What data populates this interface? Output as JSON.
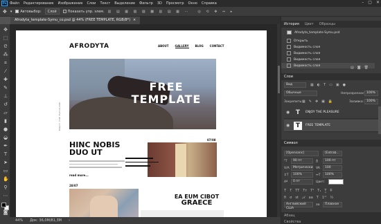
{
  "menubar": {
    "app_badge": "Ps",
    "items": [
      "Файл",
      "Редактирование",
      "Изображение",
      "Слои",
      "Текст",
      "Выделение",
      "Фильтр",
      "3D",
      "Просмотр",
      "Окно",
      "Справка"
    ]
  },
  "options": {
    "autoselect_label": "Автовыбор:",
    "layer_select": "Слой",
    "show_controls_label": "Показать упр. элем."
  },
  "document_tab": {
    "title": "Afrodyta_template-Symu_co.psd @ 44% (FREE TEMPLATE, RGB/8*)",
    "close": "×"
  },
  "page": {
    "logo": "AFRODYTA",
    "nav": [
      "ABOUT",
      "GALLERY",
      "BLOG",
      "CONTACT"
    ],
    "hero_line1": "FREE",
    "hero_line2": "TEMPLATE",
    "side_label": "ENJOY THE PLEASURE",
    "section1_heading": "HINC NOBIS DUO UT",
    "read_more": "read more...",
    "date1": "07/08",
    "date2": "28/07",
    "section2_line1": "EA EUM CIBOT",
    "section2_line2": "GRAECE"
  },
  "status": {
    "zoom": "44%",
    "doc_size": "Док: 36,0М/81,3М"
  },
  "history_panel": {
    "tabs": [
      "История",
      "Цвет",
      "Образцы"
    ],
    "snapshot": "Afrodyta_template-Symu.psd",
    "items": [
      "Открыть",
      "Видимость слоя",
      "Видимость слоя",
      "Видимость слоя",
      "Видимость слоя"
    ]
  },
  "layers_panel": {
    "tab": "Слои",
    "filter": "Вид",
    "blend_mode": "Обычные",
    "opacity_label": "Непрозрачность:",
    "opacity_value": "100%",
    "lock_label": "Закрепить:",
    "fill_label": "Заливка:",
    "fill_value": "100%",
    "layers": [
      {
        "name": "ENJOY THE PLEASURE",
        "type": "text",
        "selected": false
      },
      {
        "name": "FREE TEMPLATE",
        "type": "text",
        "selected": true
      }
    ]
  },
  "character_panel": {
    "tab": "Символ",
    "font_family": "[Opensans]",
    "font_style": "[Extrab...",
    "font_size": "90 пт",
    "leading": "100 пт",
    "kerning": "Метрически",
    "tracking": "100",
    "vscale": "100%",
    "hscale": "100%",
    "baseline": "0 пт",
    "color_label": "Цвет:",
    "language": "Английский: США",
    "aa_label": "aa",
    "aa_value": "Плавное"
  },
  "bottom_tabs": [
    "Абзац",
    "Свойства"
  ]
}
